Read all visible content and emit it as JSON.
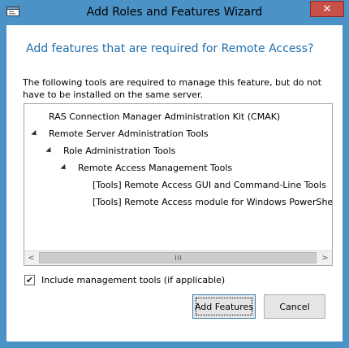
{
  "window": {
    "title": "Add Roles and Features Wizard",
    "close_symbol": "✕",
    "app_icon": "wizard-app-icon"
  },
  "dialog": {
    "heading": "Add features that are required for Remote Access?",
    "description": "The following tools are required to manage this feature, but do not have to be installed on the same server."
  },
  "tree": {
    "items": [
      {
        "label": "RAS Connection Manager Administration Kit (CMAK)",
        "expanded": false
      },
      {
        "label": "Remote Server Administration Tools",
        "expanded": true
      },
      {
        "label": "Role Administration Tools",
        "expanded": true
      },
      {
        "label": "Remote Access Management Tools",
        "expanded": true
      },
      {
        "label": "[Tools] Remote Access GUI and Command-Line Tools",
        "expanded": false
      },
      {
        "label": "[Tools] Remote Access module for Windows PowerShell",
        "expanded": false
      }
    ]
  },
  "options": {
    "include_tools_label": "Include management tools (if applicable)",
    "include_tools_checked": true,
    "check_glyph": "✔"
  },
  "buttons": {
    "add_features": "Add Features",
    "cancel": "Cancel"
  },
  "scrollbar": {
    "left_glyph": "<",
    "right_glyph": ">"
  },
  "colors": {
    "frame": "#4b92c6",
    "heading": "#1e6fb0",
    "close": "#c7504a"
  }
}
